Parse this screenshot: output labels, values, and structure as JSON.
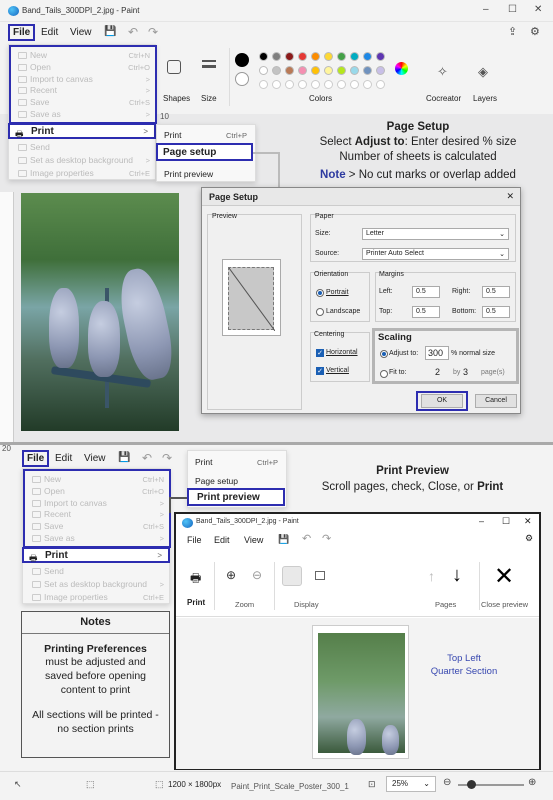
{
  "window": {
    "title": "Band_Tails_300DPI_2.jpg - Paint",
    "minimize": "–",
    "maximize": "☐",
    "close": "✕"
  },
  "menu": {
    "file": "File",
    "edit": "Edit",
    "view": "View"
  },
  "file_menu": {
    "items": [
      {
        "label": "New",
        "shortcut": "Ctrl+N"
      },
      {
        "label": "Open",
        "shortcut": "Ctrl+O"
      },
      {
        "label": "Import to canvas",
        "shortcut": ">"
      },
      {
        "label": "Recent",
        "shortcut": ">"
      },
      {
        "label": "Save",
        "shortcut": "Ctrl+S"
      },
      {
        "label": "Save as",
        "shortcut": ">"
      }
    ],
    "print": "Print",
    "print_arrow": ">",
    "lower": [
      {
        "label": "Send",
        "shortcut": ""
      },
      {
        "label": "Set as desktop background",
        "shortcut": ">"
      },
      {
        "label": "Image properties",
        "shortcut": "Ctrl+E"
      }
    ]
  },
  "print_submenu": {
    "print": "Print",
    "print_shortcut": "Ctrl+P",
    "page_setup": "Page setup",
    "print_preview": "Print preview"
  },
  "ribbon": {
    "shapes": "Shapes",
    "size": "Size",
    "colors": "Colors",
    "cocreator": "Cocreator",
    "layers": "Layers"
  },
  "palette": {
    "row1": [
      "#000000",
      "#7f7f7f",
      "#8b1a1a",
      "#e53935",
      "#fb8c00",
      "#fdd835",
      "#43a047",
      "#00acc1",
      "#1e88e5",
      "#5e35b1"
    ],
    "row2": [
      "#ffffff",
      "#c3c3c3",
      "#b97a57",
      "#f48fb1",
      "#ffc107",
      "#fff59d",
      "#b5e61d",
      "#99d9ea",
      "#7092be",
      "#c8bfe7"
    ]
  },
  "ann_page_setup": {
    "title": "Page Setup",
    "line1_a": "Select ",
    "line1_b": "Adjust to",
    "line1_c": ":  Enter desired % size",
    "line2": "Number of sheets is calculated",
    "line3_a": "Note",
    "line3_b": " > No cut marks or overlap added"
  },
  "ruler": {
    "top_label": "10",
    "tick_20": "20"
  },
  "dialog": {
    "title": "Page Setup",
    "close": "✕",
    "preview": "Preview",
    "paper": "Paper",
    "size_label": "Size:",
    "size_value": "Letter",
    "source_label": "Source:",
    "source_value": "Printer Auto Select",
    "orientation": "Orientation",
    "portrait": "Portrait",
    "landscape": "Landscape",
    "margins": "Margins",
    "left_l": "Left:",
    "left_v": "0.5",
    "right_l": "Right:",
    "right_v": "0.5",
    "top_l": "Top:",
    "top_v": "0.5",
    "bottom_l": "Bottom:",
    "bottom_v": "0.5",
    "centering": "Centering",
    "horizontal": "Horizontal",
    "vertical": "Vertical",
    "scaling": "Scaling",
    "adjust_to": "Adjust to:",
    "adjust_value": "300",
    "normal_size": "% normal size",
    "fit_to": "Fit to:",
    "fit_a": "2",
    "by": "by",
    "fit_b": "3",
    "pages": "page(s)",
    "ok": "OK",
    "cancel": "Cancel"
  },
  "ann_print_preview": {
    "title": "Print Preview",
    "line_a": "Scroll pages, check, Close, or ",
    "line_b": "Print"
  },
  "preview_window": {
    "title": "Band_Tails_300DPI_2.jpg - Paint",
    "file": "File",
    "edit": "Edit",
    "view": "View",
    "print": "Print",
    "zoom": "Zoom",
    "display": "Display",
    "pages": "Pages",
    "close_preview": "Close preview",
    "caption1": "Top Left",
    "caption2": "Quarter Section"
  },
  "notes": {
    "title": "Notes",
    "heading": "Printing Preferences",
    "body": "must be adjusted and saved before opening content to print",
    "footer": "All sections will be printed - no section prints"
  },
  "status": {
    "dimensions": "1200 × 1800px",
    "filename": "Paint_Print_Scale_Poster_300_1",
    "zoom": "25%"
  }
}
